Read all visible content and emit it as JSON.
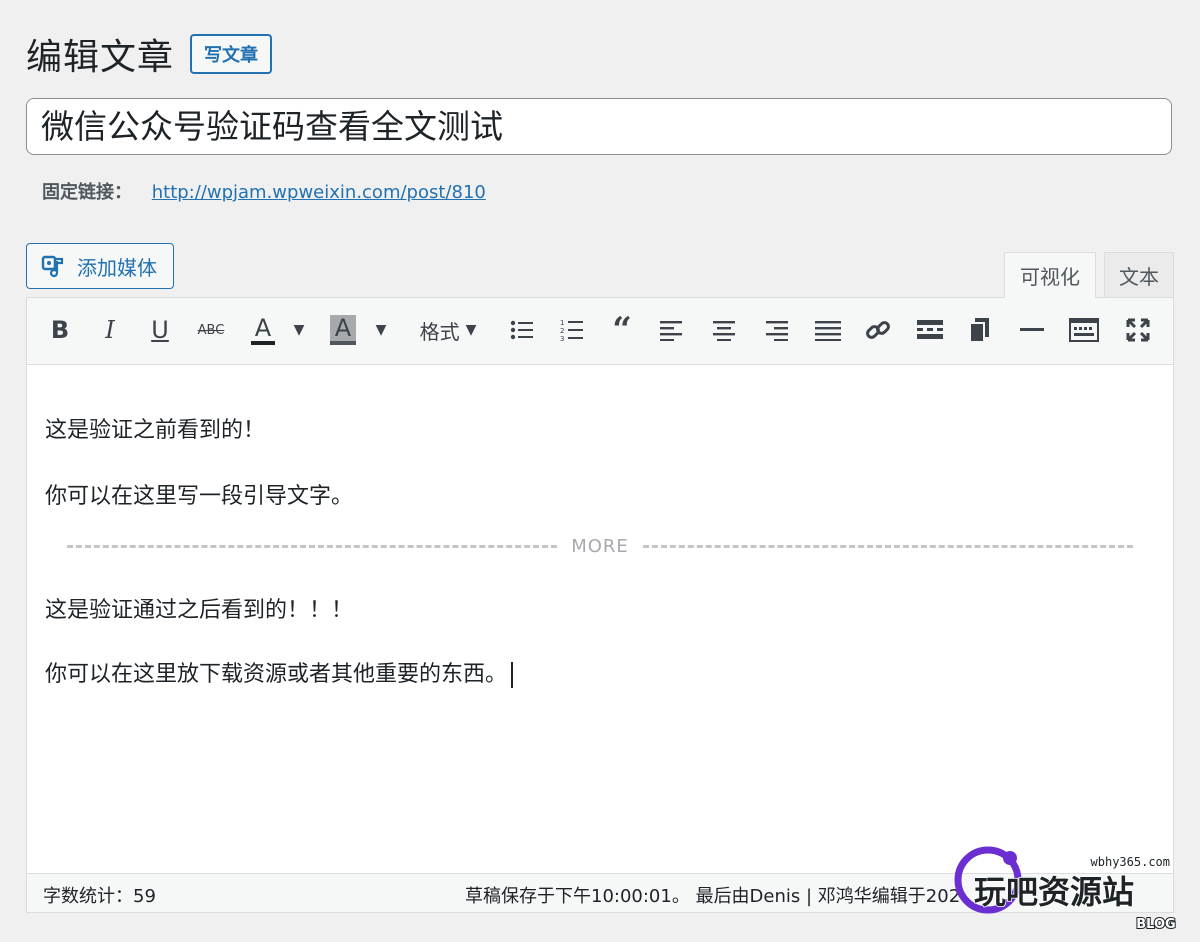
{
  "header": {
    "title": "编辑文章",
    "add_new": "写文章"
  },
  "post": {
    "title": "微信公众号验证码查看全文测试"
  },
  "permalink": {
    "label": "固定链接：",
    "url": "http://wpjam.wpweixin.com/post/810"
  },
  "media": {
    "add_label": "添加媒体"
  },
  "tabs": {
    "visual": "可视化",
    "text": "文本"
  },
  "toolbar": {
    "bold": "B",
    "italic": "I",
    "underline": "U",
    "strike": "ABC",
    "text_color": "A",
    "bg_color": "A",
    "format": "格式",
    "more_dashes": "MORE"
  },
  "content": {
    "p1": "这是验证之前看到的！",
    "p2": "你可以在这里写一段引导文字。",
    "p3": "这是验证通过之后看到的！！！",
    "p4": "你可以在这里放下载资源或者其他重要的东西。"
  },
  "status": {
    "word_count": "字数统计：59",
    "saved": "草稿保存于下午10:00:01。 最后由Denis | 邓鸿华编辑于202"
  },
  "watermark": {
    "site": "wbhy365.com",
    "brand": "玩吧资源站",
    "sub": "BLOG"
  },
  "colors": {
    "accent": "#2271b1",
    "bg": "#f0f0f1",
    "toolbar": "#f6f7f7",
    "watermark": "#6b2fd1"
  }
}
